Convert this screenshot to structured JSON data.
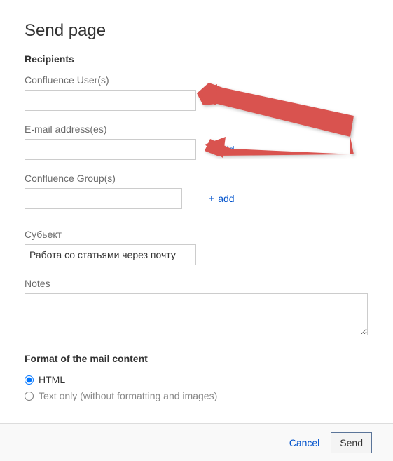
{
  "page": {
    "title": "Send page"
  },
  "sections": {
    "recipients_heading": "Recipients",
    "format_heading": "Format of the mail content"
  },
  "fields": {
    "confluence_users": {
      "label": "Confluence User(s)",
      "value": "",
      "add_label": "add"
    },
    "email_addresses": {
      "label": "E-mail address(es)",
      "value": "",
      "add_label": "add"
    },
    "confluence_groups": {
      "label": "Confluence Group(s)",
      "value": "",
      "add_label": "add"
    },
    "subject": {
      "label": "Субьект",
      "value": "Работа со статьями через почту"
    },
    "notes": {
      "label": "Notes",
      "value": ""
    }
  },
  "format_options": {
    "html": "HTML",
    "text_only": "Text only (without formatting and images)"
  },
  "actions": {
    "cancel": "Cancel",
    "send": "Send"
  }
}
